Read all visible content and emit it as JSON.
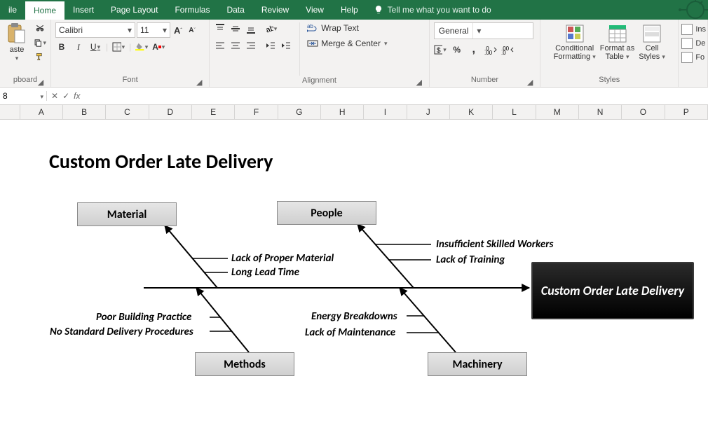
{
  "tabs": {
    "file": "ile",
    "home": "Home",
    "insert": "Insert",
    "pagelayout": "Page Layout",
    "formulas": "Formulas",
    "data": "Data",
    "review": "Review",
    "view": "View",
    "help": "Help",
    "tellme": "Tell me what you want to do"
  },
  "ribbon": {
    "clipboard": {
      "paste": "aste",
      "label": "pboard"
    },
    "font": {
      "name": "Calibri",
      "size": "11",
      "bold": "B",
      "italic": "I",
      "underline": "U",
      "label": "Font"
    },
    "alignment": {
      "wrap": "Wrap Text",
      "merge": "Merge & Center",
      "label": "Alignment"
    },
    "number": {
      "format": "General",
      "label": "Number"
    },
    "styles": {
      "cond": "Conditional",
      "cond2": "Formatting",
      "fmt": "Format as",
      "fmt2": "Table",
      "cell": "Cell",
      "cell2": "Styles",
      "label": "Styles"
    },
    "right": {
      "ins": "Ins",
      "de": "De",
      "fo": "Fo"
    }
  },
  "namebox": "8",
  "columns": [
    "A",
    "B",
    "C",
    "D",
    "E",
    "F",
    "G",
    "H",
    "I",
    "J",
    "K",
    "L",
    "M",
    "N",
    "O",
    "P"
  ],
  "diagram": {
    "title": "Custom Order Late Delivery",
    "head": "Custom Order Late Delivery",
    "categories": {
      "material": "Material",
      "people": "People",
      "methods": "Methods",
      "machinery": "Machinery"
    },
    "causes": {
      "material": [
        "Lack of Proper Material",
        "Long Lead Time"
      ],
      "people": [
        "Insufficient Skilled Workers",
        "Lack of Training"
      ],
      "methods": [
        "Poor Building Practice",
        "No Standard Delivery Procedures"
      ],
      "machinery": [
        "Energy Breakdowns",
        "Lack of Maintenance"
      ]
    }
  }
}
